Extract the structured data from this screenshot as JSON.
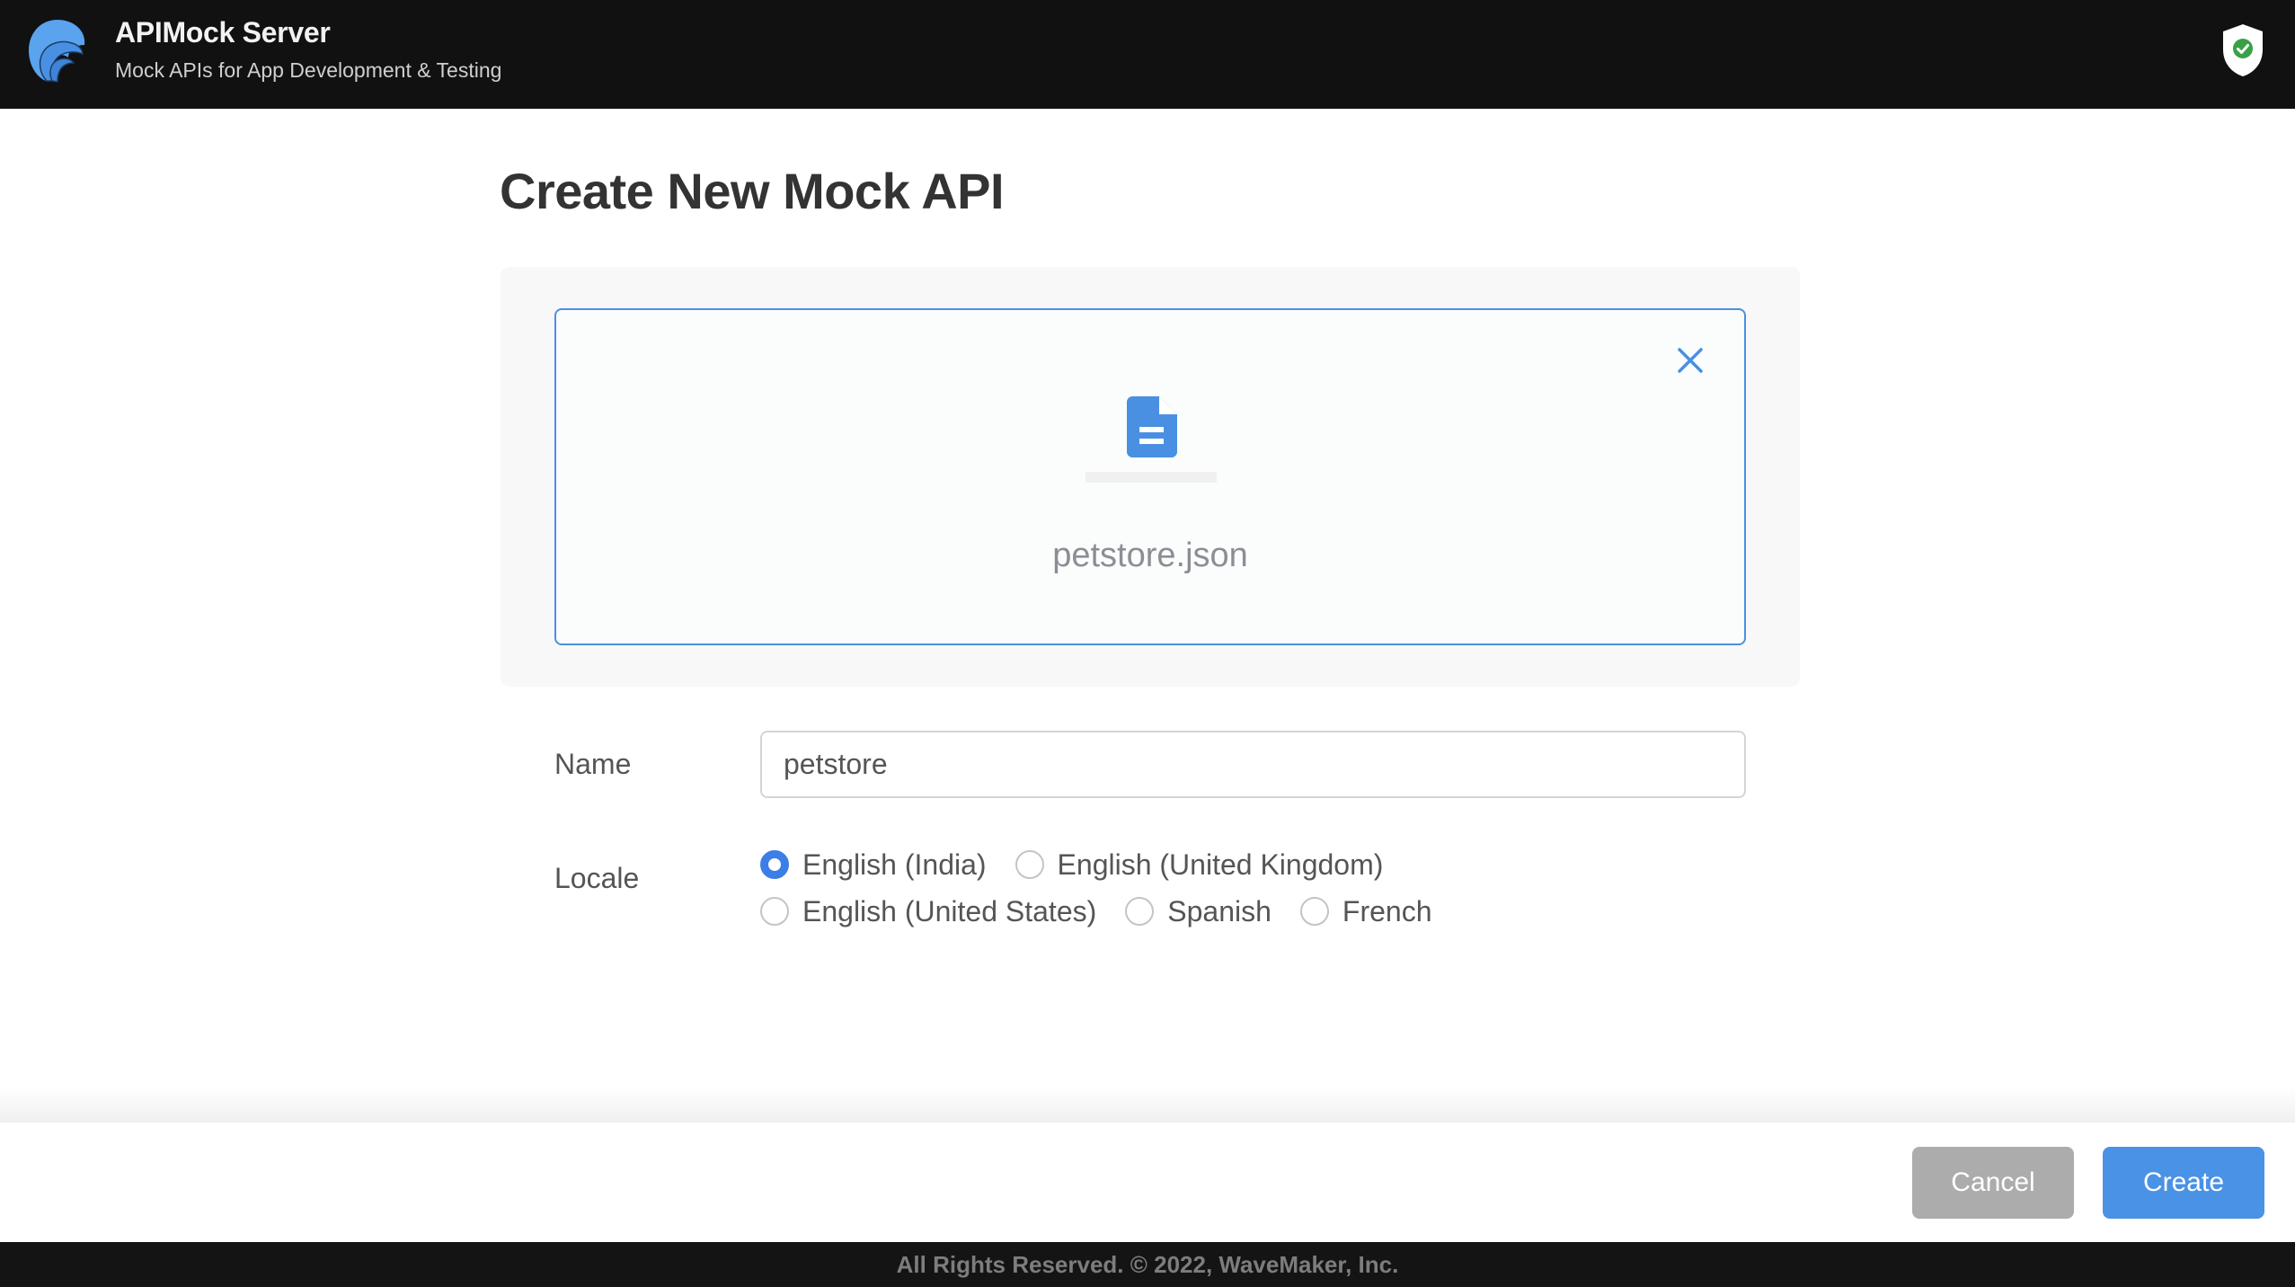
{
  "header": {
    "app_title": "APIMock Server",
    "app_subtitle": "Mock APIs for App Development & Testing",
    "logo_icon": "wave-logo",
    "status_icon": "shield-check-icon"
  },
  "page": {
    "title": "Create New Mock API"
  },
  "upload": {
    "file_icon": "document-icon",
    "close_icon": "close-icon",
    "file_name": "petstore.json",
    "accent_color": "#4a90e2"
  },
  "form": {
    "name_label": "Name",
    "name_value": "petstore",
    "locale_label": "Locale",
    "locale_options": [
      {
        "label": "English (India)",
        "checked": true
      },
      {
        "label": "English (United Kingdom)",
        "checked": false
      },
      {
        "label": "English (United States)",
        "checked": false
      },
      {
        "label": "Spanish",
        "checked": false
      },
      {
        "label": "French",
        "checked": false
      }
    ],
    "selected_locale": "English (India)"
  },
  "actions": {
    "cancel_label": "Cancel",
    "create_label": "Create",
    "cancel_color": "#acacac",
    "create_color": "#4a92e6"
  },
  "footer": {
    "copyright": "All Rights Reserved. © 2022, WaveMaker, Inc."
  }
}
